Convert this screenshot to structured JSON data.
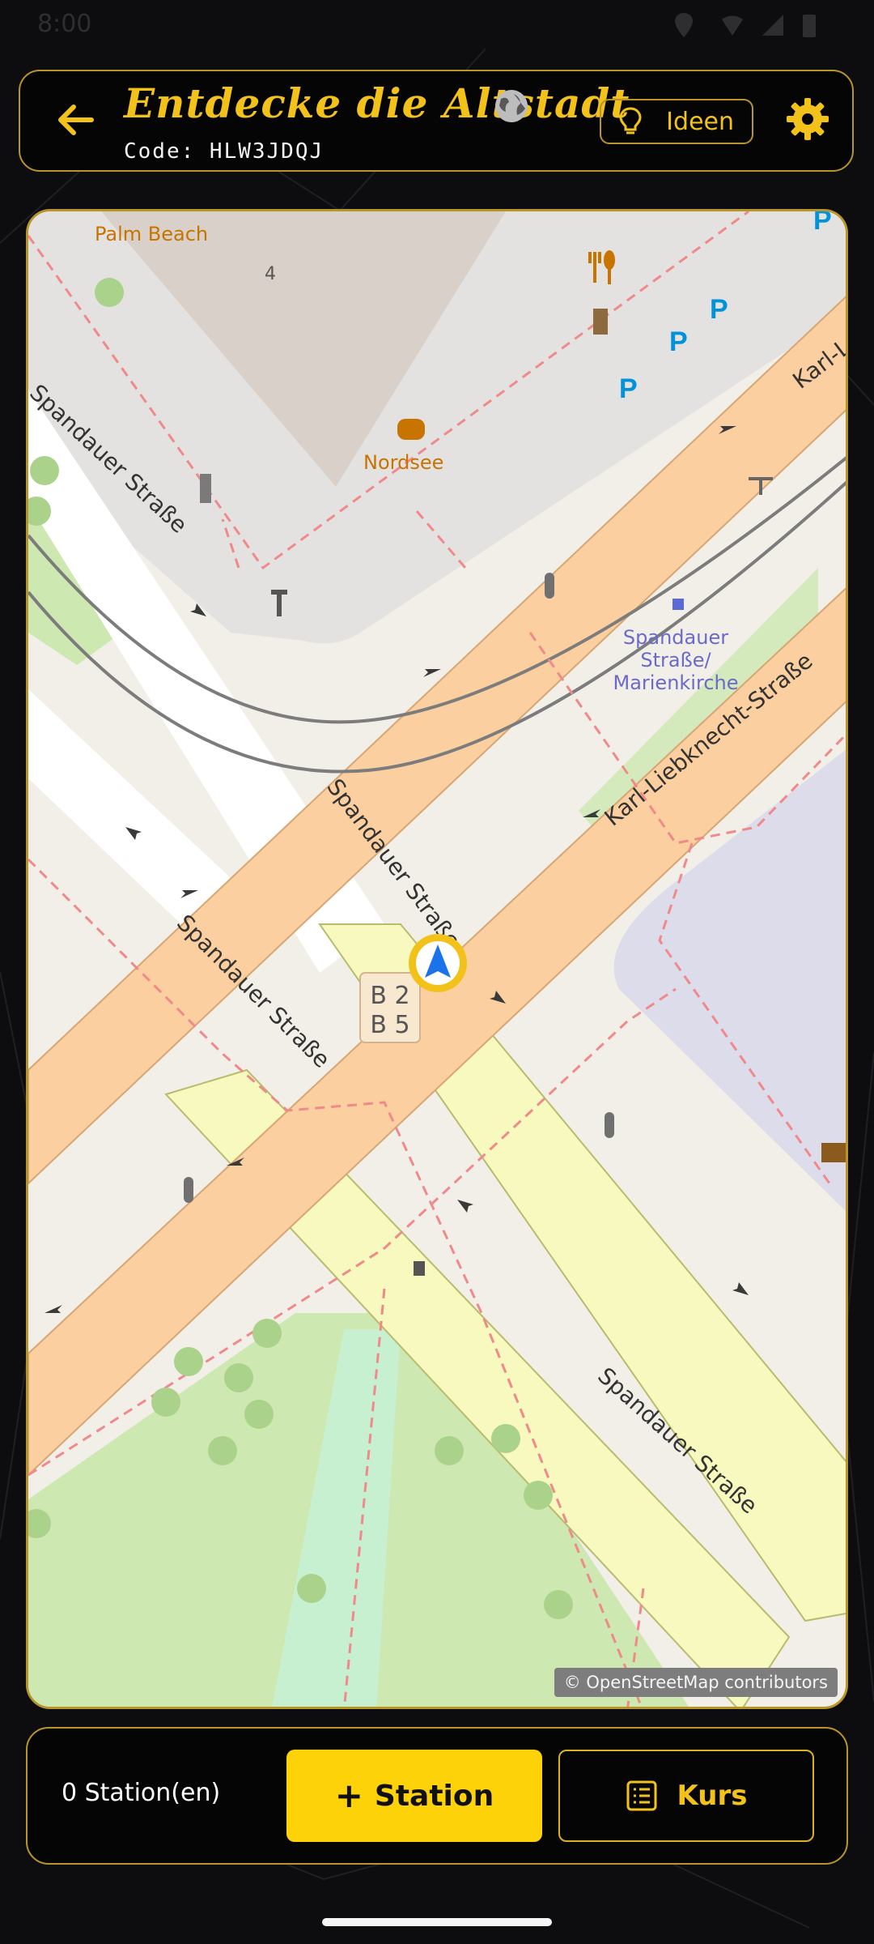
{
  "status": {
    "time": "8:00"
  },
  "header": {
    "title": "Entdecke die Altstadt",
    "code": "Code: HLW3JDQJ",
    "ideas_label": "Ideen"
  },
  "map": {
    "attribution": "© OpenStreetMap contributors",
    "labels": {
      "palm_beach": "Palm Beach",
      "house_number": "4",
      "nordsee": "Nordsee",
      "spandauer_1": "Spandauer Straße",
      "spandauer_2": "Spandauer Straße",
      "spandauer_3": "Spandauer Straße",
      "spandauer_4": "Spandauer Straße",
      "karl_1": "Karl-Liebknecht-Straße",
      "karl_2": "Karl-L",
      "stop_line1": "Spandauer",
      "stop_line2": "Straße/",
      "stop_line3": "Marienkirche",
      "route_b2": "B 2",
      "route_b5": "B 5"
    },
    "colors": {
      "primary_road": "#fbcf9f",
      "secondary_road": "#f7f9be",
      "park": "#cde8b0",
      "building": "#d8d0c9",
      "accent": "#f2c21b"
    }
  },
  "bottom": {
    "station_count": "0 Station(en)",
    "add_station_label": "Station",
    "course_label": "Kurs"
  }
}
